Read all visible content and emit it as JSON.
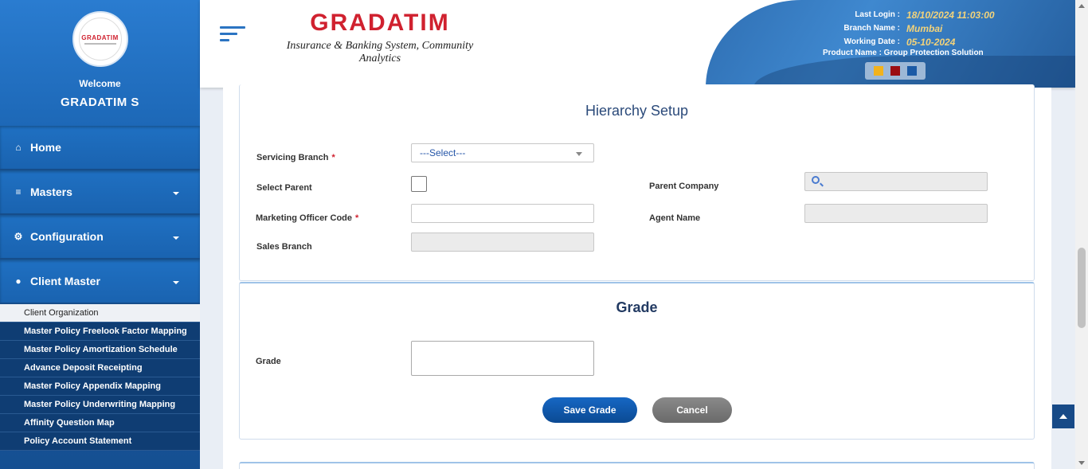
{
  "sidebar": {
    "brand_mini": "GRADATIM",
    "welcome": "Welcome",
    "username": "GRADATIM S",
    "nav": [
      {
        "label": "Home",
        "icon": "home-icon"
      },
      {
        "label": "Masters",
        "icon": "database-icon"
      },
      {
        "label": "Configuration",
        "icon": "gears-icon"
      },
      {
        "label": "Client Master",
        "icon": "user-icon"
      }
    ],
    "submenu": [
      "Client Organization",
      "Master Policy Freelook Factor Mapping",
      "Master Policy Amortization Schedule",
      "Advance Deposit Receipting",
      "Master Policy Appendix Mapping",
      "Master Policy Underwriting Mapping",
      "Affinity Question Map",
      "Policy Account Statement"
    ]
  },
  "header": {
    "brand_name": "GRADATIM",
    "brand_tagline": "Insurance & Banking System, Community Analytics",
    "last_login_label": "Last Login :",
    "last_login": "18/10/2024 11:03:00",
    "branch_name_label": "Branch Name :",
    "branch_name": "Mumbai",
    "working_date_label": "Working Date :",
    "working_date": "05-10-2024",
    "product_name": "Product Name : Group Protection Solution",
    "theme_colors": [
      "#f2b21c",
      "#9b0d12",
      "#1b5aa6"
    ]
  },
  "hierarchy": {
    "title": "Hierarchy Setup",
    "servicing_branch_label": "Servicing Branch",
    "servicing_branch_value": "---Select---",
    "select_parent_label": "Select Parent",
    "parent_company_label": "Parent Company",
    "marketing_officer_label": "Marketing Officer Code",
    "agent_name_label": "Agent Name",
    "sales_branch_label": "Sales Branch",
    "required_mark": "*"
  },
  "grade": {
    "title": "Grade",
    "grade_label": "Grade",
    "save_label": "Save Grade",
    "cancel_label": "Cancel"
  }
}
